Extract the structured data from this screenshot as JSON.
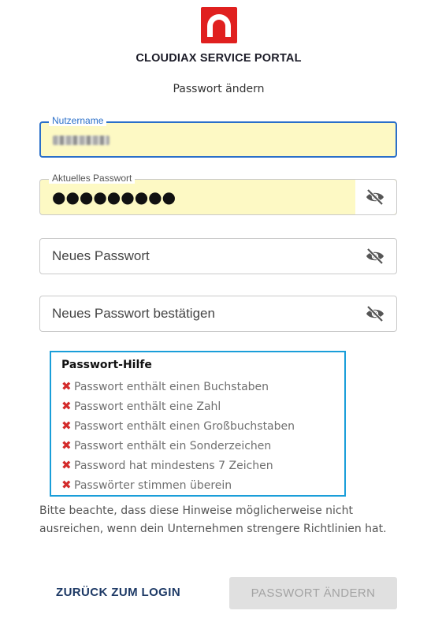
{
  "header": {
    "logo_icon": "cloudiax-logo",
    "brand_color": "#e0201f",
    "title": "CLOUDIAX SERVICE PORTAL",
    "subtitle": "Passwort ändern"
  },
  "form": {
    "username": {
      "label": "Nutzername",
      "value_obscured": true,
      "state": "focused",
      "autofilled": true
    },
    "current_password": {
      "label": "Aktuelles Passwort",
      "masked_value": "●●●●●●●●●",
      "autofilled": true,
      "toggle_icon": "eye-off-icon"
    },
    "new_password": {
      "placeholder": "Neues Passwort",
      "toggle_icon": "eye-off-icon"
    },
    "confirm_password": {
      "placeholder": "Neues Passwort bestätigen",
      "toggle_icon": "eye-off-icon"
    }
  },
  "password_help": {
    "title": "Passwort-Hilfe",
    "border_color": "#1a9ed9",
    "fail_icon": "cross-icon",
    "fail_color": "#d32b2b",
    "rules": [
      {
        "text": "Passwort enthält einen Buchstaben",
        "met": false
      },
      {
        "text": "Passwort enthält eine Zahl",
        "met": false
      },
      {
        "text": "Passwort enthält einen Großbuchstaben",
        "met": false
      },
      {
        "text": "Passwort enthält ein Sonderzeichen",
        "met": false
      },
      {
        "text": "Password hat mindestens 7 Zeichen",
        "met": false
      },
      {
        "text": "Passwörter stimmen überein",
        "met": false
      }
    ]
  },
  "note": "Bitte beachte, dass diese Hinweise möglicherweise nicht ausreichen, wenn dein Unternehmen strengere Richtlinien hat.",
  "actions": {
    "back_label": "ZURÜCK ZUM LOGIN",
    "submit_label": "PASSWORT ÄNDERN",
    "submit_disabled": true
  }
}
